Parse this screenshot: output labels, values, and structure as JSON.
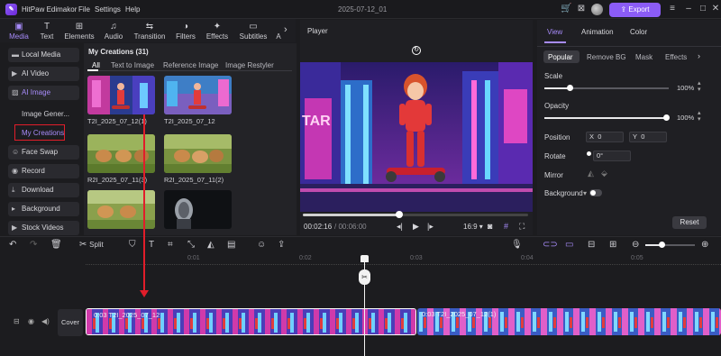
{
  "app": {
    "name": "HitPaw Edimakor",
    "menu": [
      "File",
      "Settings",
      "Help"
    ],
    "window_title": "2025-07-12_01",
    "export_label": "Export"
  },
  "tooltabs": [
    {
      "label": "Media",
      "icon": "media-icon"
    },
    {
      "label": "Text",
      "icon": "text-icon"
    },
    {
      "label": "Elements",
      "icon": "elements-icon"
    },
    {
      "label": "Audio",
      "icon": "audio-icon"
    },
    {
      "label": "Transition",
      "icon": "transition-icon"
    },
    {
      "label": "Filters",
      "icon": "filters-icon"
    },
    {
      "label": "Effects",
      "icon": "effects-icon"
    },
    {
      "label": "Subtitles",
      "icon": "subtitles-icon"
    },
    {
      "label": "A",
      "icon": "ai-icon"
    }
  ],
  "sidebar": {
    "items": [
      {
        "label": "Local Media",
        "icon": "folder-icon"
      },
      {
        "label": "AI Video",
        "icon": "ai-video-icon"
      },
      {
        "label": "AI Image",
        "icon": "ai-image-icon"
      }
    ],
    "subitems": [
      "Image Gener...",
      "My Creations"
    ],
    "items2": [
      {
        "label": "Face Swap",
        "icon": "face-swap-icon"
      },
      {
        "label": "Record",
        "icon": "record-icon"
      },
      {
        "label": "Download",
        "icon": "download-icon"
      },
      {
        "label": "Background",
        "icon": "background-icon"
      },
      {
        "label": "Stock Videos",
        "icon": "stock-icon"
      }
    ]
  },
  "browser": {
    "title": "My Creations (31)",
    "filters": [
      "All",
      "Text to Image",
      "Reference Image",
      "Image Restyler"
    ],
    "items": [
      {
        "label": "T2I_2025_07_12(1)"
      },
      {
        "label": "T2I_2025_07_12"
      },
      {
        "label": "R2I_2025_07_11(3)"
      },
      {
        "label": "R2I_2025_07_11(2)"
      },
      {
        "label": ""
      },
      {
        "label": ""
      }
    ]
  },
  "player": {
    "title": "Player",
    "current_time": "00:02:16",
    "total_time": "/ 00:06:00",
    "aspect": "16:9",
    "progress": 0.43
  },
  "props": {
    "tabs": [
      "View",
      "Animation",
      "Color"
    ],
    "subtabs": [
      "Popular",
      "Remove BG",
      "Mask",
      "Effects"
    ],
    "scale_label": "Scale",
    "scale_value": "100%",
    "opacity_label": "Opacity",
    "opacity_value": "100%",
    "position_label": "Position",
    "x_label": "X",
    "x_value": "0",
    "y_label": "Y",
    "y_value": "0",
    "rotate_label": "Rotate",
    "rotate_value": "0°",
    "mirror_label": "Mirror",
    "background_label": "Background",
    "reset_label": "Reset"
  },
  "timeline": {
    "split_label": "Split",
    "ruler": [
      "0:01",
      "0:02",
      "0:03",
      "0:04",
      "0:05"
    ],
    "cover_label": "Cover",
    "clips": [
      {
        "label": "0:03  T2I_2025_07_12"
      },
      {
        "label": "0:03  T2I_2025_07_12(1)"
      }
    ]
  },
  "colors": {
    "accent": "#8b5cf6",
    "highlight": "#e11d2a"
  }
}
